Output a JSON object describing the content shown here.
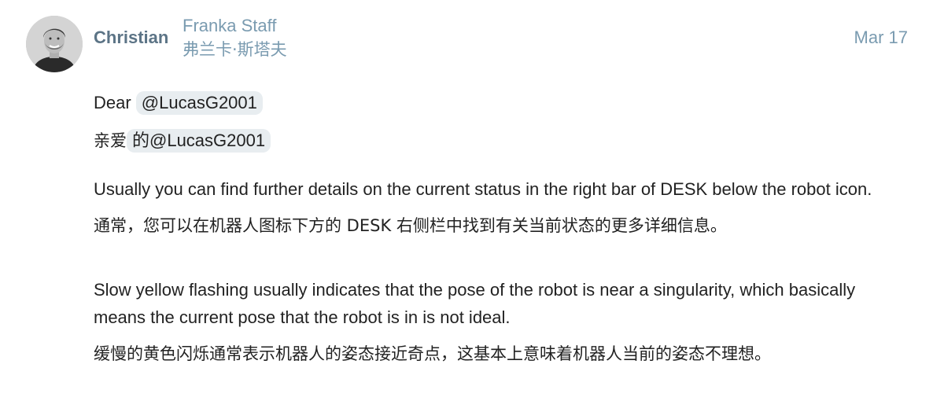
{
  "post": {
    "avatar_alt": "Christian avatar",
    "username": "Christian",
    "user_title": "Franka Staff",
    "user_title_cn": "弗兰卡·斯塔夫",
    "date": "Mar 17"
  },
  "content": {
    "greeting_prefix": "Dear ",
    "greeting_mention": "@LucasG2001",
    "greeting_cn_prefix": "亲爱",
    "greeting_cn_mention": "的@LucasG2001",
    "para1": "Usually you can find further details on the current status in the right bar of DESK below the robot icon.",
    "para1_cn": "通常，您可以在机器人图标下方的 DESK 右侧栏中找到有关当前状态的更多详细信息。",
    "para2": "Slow yellow flashing usually indicates that the pose of the robot is near a singularity, which basically means the current pose that the robot is in is not ideal.",
    "para2_cn": "缓慢的黄色闪烁通常表示机器人的姿态接近奇点，这基本上意味着机器人当前的姿态不理想。"
  },
  "colors": {
    "username": "#5c7486",
    "meta": "#7a9bb0",
    "mention_bg": "#e8edf0",
    "text": "#222222"
  }
}
